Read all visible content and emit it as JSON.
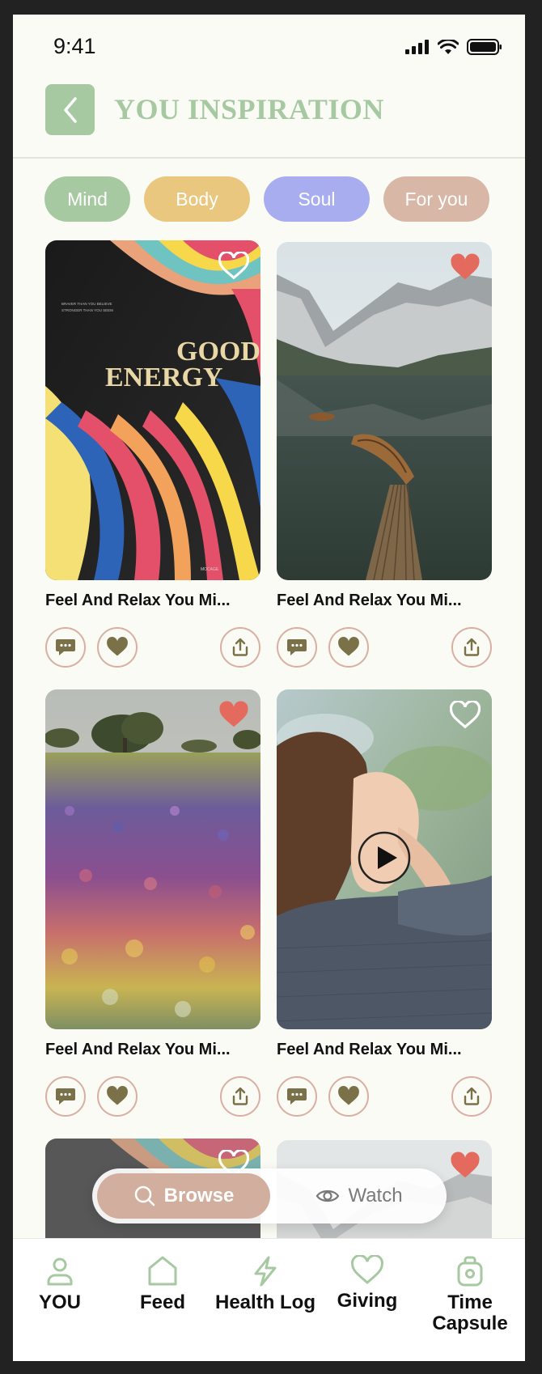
{
  "status_bar": {
    "time": "9:41"
  },
  "header": {
    "title": "YOU INSPIRATION"
  },
  "filters": [
    {
      "label": "Mind",
      "color": "#A6C9A1"
    },
    {
      "label": "Body",
      "color": "#E9C77E"
    },
    {
      "label": "Soul",
      "color": "#A8ADF0"
    },
    {
      "label": "For you",
      "color": "#D8B7A7"
    }
  ],
  "cards": [
    {
      "title": "Feel And Relax You Mi...",
      "favorited": false,
      "poster_text_1": "GOOD",
      "poster_text_2": "ENERGY",
      "poster_small": "MOCAGE"
    },
    {
      "title": "Feel And Relax You Mi...",
      "favorited": true
    },
    {
      "title": "Feel And Relax You Mi...",
      "favorited": true
    },
    {
      "title": "Feel And Relax You Mi...",
      "favorited": false,
      "video": true
    },
    {
      "favorited": false
    },
    {
      "favorited": true
    }
  ],
  "view_switch": {
    "browse_label": "Browse",
    "watch_label": "Watch"
  },
  "bottom_nav": [
    {
      "label": "YOU",
      "icon": "user-icon"
    },
    {
      "label": "Feed",
      "icon": "home-icon"
    },
    {
      "label": "Health Log",
      "icon": "bolt-icon"
    },
    {
      "label": "Giving",
      "icon": "heart-icon"
    },
    {
      "label": "Time Capsule",
      "icon": "capsule-icon"
    }
  ],
  "colors": {
    "accent_green": "#A6C9A1",
    "action_border": "#D9AFA4",
    "action_fill": "#7A7148",
    "heart_red": "#E56A5E",
    "background": "#FAFBF4"
  }
}
